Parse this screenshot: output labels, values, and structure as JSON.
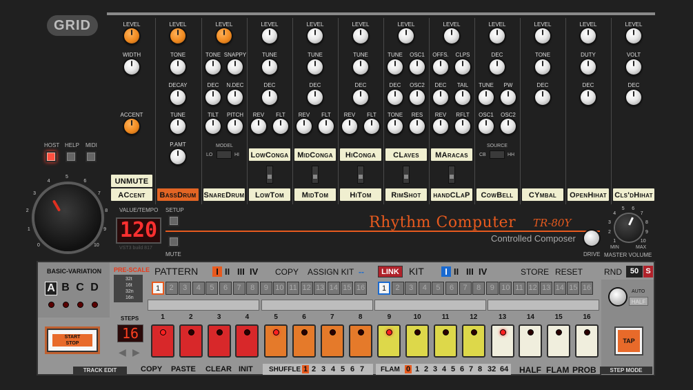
{
  "brand": {
    "logo": "GRID"
  },
  "host_buttons": {
    "host": "HOST",
    "help": "HELP",
    "midi": "MIDI"
  },
  "instruments": [
    {
      "key": "ac",
      "row1": [
        "LEVEL"
      ],
      "row2": [
        "WIDTH"
      ],
      "row4": [
        "ACCENT"
      ],
      "button": "ACcent"
    },
    {
      "key": "bd",
      "row1": [
        "LEVEL"
      ],
      "row2": [
        "TONE"
      ],
      "row3": [
        "DECAY"
      ],
      "row4": [
        "TUNE"
      ],
      "row5": [
        "P.AMT"
      ],
      "button": "BassDrum"
    },
    {
      "key": "sd",
      "row1": [
        "LEVEL"
      ],
      "row2": [
        "TONE",
        "SNAPPY"
      ],
      "row3": [
        "DEC",
        "N.DEC"
      ],
      "row4": [
        "TILT",
        "PITCH"
      ],
      "model": "MODEL",
      "lo": "LO",
      "hi": "HI",
      "button": "SnareDrum"
    },
    {
      "key": "lt",
      "row1": [
        "LEVEL"
      ],
      "row2": [
        "TUNE"
      ],
      "row3": [
        "DEC"
      ],
      "row4": [
        "REV",
        "FLT"
      ],
      "alt": "LowConga",
      "button": "LowTom"
    },
    {
      "key": "mt",
      "row1": [
        "LEVEL"
      ],
      "row2": [
        "TUNE"
      ],
      "row3": [
        "DEC"
      ],
      "row4": [
        "REV",
        "FLT"
      ],
      "alt": "MidConga",
      "button": "MidTom"
    },
    {
      "key": "ht",
      "row1": [
        "LEVEL"
      ],
      "row2": [
        "TUNE"
      ],
      "row3": [
        "DEC"
      ],
      "row4": [
        "REV",
        "FLT"
      ],
      "alt": "HiConga",
      "button": "HiTom"
    },
    {
      "key": "rs",
      "row1": [
        "LEVEL"
      ],
      "row2": [
        "TUNE",
        "OSC1"
      ],
      "row3": [
        "DEC",
        "OSC2"
      ],
      "row4": [
        "TONE",
        "RES"
      ],
      "alt": "CLaves",
      "button": "RimShot"
    },
    {
      "key": "hc",
      "row1": [
        "LEVEL"
      ],
      "row2": [
        "OFFS.",
        "CLPS"
      ],
      "row3": [
        "DEC",
        "TAIL"
      ],
      "row4": [
        "REV",
        "RFLT"
      ],
      "alt": "MAracas",
      "button": "handCLaP"
    },
    {
      "key": "cb",
      "row1": [
        "LEVEL"
      ],
      "row2": [
        "DEC"
      ],
      "row3": [
        "TUNE",
        "PW"
      ],
      "row4": [
        "OSC1",
        "OSC2"
      ],
      "source": "SOURCE",
      "cbl": "CB",
      "hhl": "HH",
      "button": "CowBell"
    },
    {
      "key": "cy",
      "row1": [
        "LEVEL"
      ],
      "row2": [
        "TONE"
      ],
      "row3": [
        "DEC"
      ],
      "button": "CYmbal"
    },
    {
      "key": "oh",
      "row1": [
        "LEVEL"
      ],
      "row2": [
        "DUTY"
      ],
      "row3": [
        "DEC"
      ],
      "button": "OpenHihat"
    },
    {
      "key": "ch",
      "row1": [
        "LEVEL"
      ],
      "row2": [
        "VOLT"
      ],
      "row3": [
        "DEC"
      ],
      "button": "Cls'dHihat"
    }
  ],
  "unmute": "UNMUTE",
  "tempo": {
    "label": "VALUE/TEMPO",
    "value": "120",
    "setup": "SETUP",
    "mute": "MUTE",
    "build": "VST3 build 817"
  },
  "title": {
    "main": "Rhythm Computer",
    "model": "TR-80Y",
    "sub": "Controlled Composer",
    "drive": "DRIVE",
    "master": "MASTER VOLUME",
    "min": "MIN",
    "max": "MAX"
  },
  "dial_ticks": [
    "0",
    "1",
    "2",
    "3",
    "4",
    "5",
    "6",
    "7",
    "8",
    "9",
    "10"
  ],
  "lower": {
    "basic_variation": "BASIC-VARIATION",
    "variations": [
      "A",
      "B",
      "C",
      "D"
    ],
    "start_stop": [
      "START",
      "STOP"
    ],
    "prescale": "PRE-SCALE",
    "prescale_opts": [
      "32t",
      "16t",
      "32n",
      "16n"
    ],
    "steps_label": "STEPS",
    "steps_value": "16",
    "pattern": "PATTERN",
    "pattern_banks": [
      "I",
      "II",
      "III",
      "IV"
    ],
    "copy": "COPY",
    "assign_kit": "ASSIGN KIT",
    "dash": "--",
    "link": "LINK",
    "kit": "KIT",
    "kit_banks": [
      "I",
      "II",
      "III",
      "IV"
    ],
    "store": "STORE",
    "reset": "RESET",
    "rnd": "RND",
    "rnd_value": "50",
    "s_btn": "S",
    "numbers": [
      "1",
      "2",
      "3",
      "4",
      "5",
      "6",
      "7",
      "8",
      "9",
      "10",
      "11",
      "12",
      "13",
      "14",
      "15",
      "16"
    ],
    "auto": "AUTO",
    "half_btn": "HALF",
    "tap": "TAP",
    "track_edit": "TRACK EDIT",
    "edit_ops": [
      "COPY",
      "PASTE",
      "CLEAR",
      "INIT"
    ],
    "shuffle": "SHUFFLE",
    "shuffle_vals": [
      "1",
      "2",
      "3",
      "4",
      "5",
      "6",
      "7"
    ],
    "flam": "FLAM",
    "flam_vals": [
      "0",
      "1",
      "2",
      "3",
      "4",
      "5",
      "6",
      "7",
      "8",
      "32",
      "64"
    ],
    "mode_ops": [
      "HALF",
      "FLAM",
      "PROB"
    ],
    "step_mode": "STEP MODE"
  },
  "steps": [
    {
      "n": "1",
      "color": "#d8282a",
      "led": true
    },
    {
      "n": "2",
      "color": "#d8282a",
      "led": false
    },
    {
      "n": "3",
      "color": "#d8282a",
      "led": false
    },
    {
      "n": "4",
      "color": "#d8282a",
      "led": false
    },
    {
      "n": "5",
      "color": "#e57a2a",
      "led": true
    },
    {
      "n": "6",
      "color": "#e57a2a",
      "led": false
    },
    {
      "n": "7",
      "color": "#e57a2a",
      "led": false
    },
    {
      "n": "8",
      "color": "#e57a2a",
      "led": false
    },
    {
      "n": "9",
      "color": "#ddd84a",
      "led": true
    },
    {
      "n": "10",
      "color": "#ddd84a",
      "led": false
    },
    {
      "n": "11",
      "color": "#ddd84a",
      "led": false
    },
    {
      "n": "12",
      "color": "#ddd84a",
      "led": false
    },
    {
      "n": "13",
      "color": "#f0eedd",
      "led": true
    },
    {
      "n": "14",
      "color": "#f0eedd",
      "led": false
    },
    {
      "n": "15",
      "color": "#f0eedd",
      "led": false
    },
    {
      "n": "16",
      "color": "#f0eedd",
      "led": false
    }
  ],
  "colors": {
    "accent": "#e85a1e",
    "display_red": "#ff3030",
    "cream": "#f0efd0"
  }
}
